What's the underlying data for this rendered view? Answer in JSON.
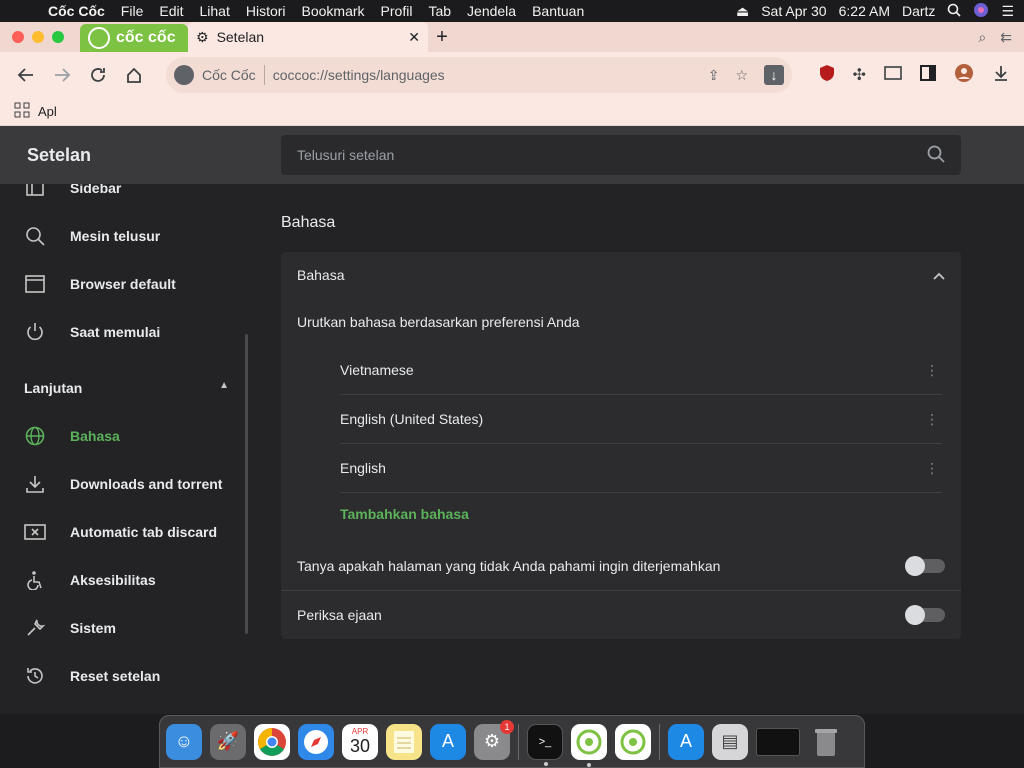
{
  "menubar": {
    "app_name": "Cốc Cốc",
    "items": [
      "File",
      "Edit",
      "Lihat",
      "Histori",
      "Bookmark",
      "Profil",
      "Tab",
      "Jendela",
      "Bantuan"
    ],
    "date": "Sat Apr 30",
    "time": "6:22 AM",
    "user": "Dartz"
  },
  "tabs": {
    "brand_label": "cốc cốc",
    "active_title": "Setelan"
  },
  "omnibox": {
    "site_name": "Cốc Cốc",
    "url": "coccoc://settings/languages"
  },
  "bookmarks": {
    "apps_label": "Apl"
  },
  "settings": {
    "title": "Setelan",
    "search_placeholder": "Telusuri setelan",
    "sidebar": {
      "items_top": [
        {
          "label": "Sidebar",
          "icon": "sidebar-icon"
        },
        {
          "label": "Mesin telusur",
          "icon": "search-icon"
        },
        {
          "label": "Browser default",
          "icon": "browser-icon"
        },
        {
          "label": "Saat memulai",
          "icon": "power-icon"
        }
      ],
      "section_label": "Lanjutan",
      "items_advanced": [
        {
          "label": "Bahasa",
          "icon": "globe-icon",
          "active": true
        },
        {
          "label": "Downloads and torrent",
          "icon": "download-icon"
        },
        {
          "label": "Automatic tab discard",
          "icon": "tab-discard-icon"
        },
        {
          "label": "Aksesibilitas",
          "icon": "accessibility-icon"
        },
        {
          "label": "Sistem",
          "icon": "wrench-icon"
        },
        {
          "label": "Reset setelan",
          "icon": "reset-icon"
        }
      ]
    },
    "main": {
      "section_title": "Bahasa",
      "card_title": "Bahasa",
      "order_label": "Urutkan bahasa berdasarkan preferensi Anda",
      "languages": [
        "Vietnamese",
        "English (United States)",
        "English"
      ],
      "add_language": "Tambahkan bahasa",
      "translate_label": "Tanyа apakah halaman yang tidak Anda pahami ingin diterjemahkan",
      "translate_enabled": false,
      "spellcheck_label": "Periksa ejaan",
      "spellcheck_enabled": false
    }
  },
  "dock": {
    "calendar_month": "APR",
    "calendar_day": "30",
    "settings_badge": "1"
  },
  "colors": {
    "accent_green": "#5bb25b",
    "brand_green": "#7dc242",
    "traffic_red": "#ff5f57",
    "traffic_yellow": "#febc2e",
    "traffic_green": "#28c840"
  }
}
